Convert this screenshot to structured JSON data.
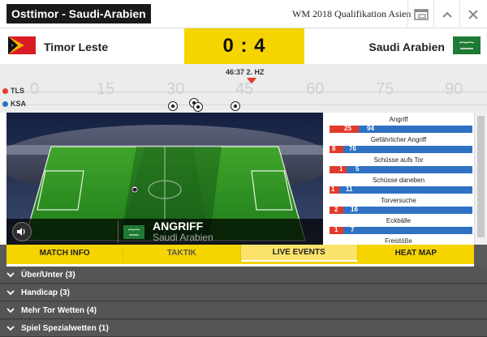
{
  "header": {
    "title": "Osttimor - Saudi-Arabien",
    "competition": "WM 2018 Qualifikation Asien"
  },
  "match": {
    "home_team": "Timor Leste",
    "away_team": "Saudi Arabien",
    "score": "0 : 4",
    "clock": "46:37 2. HZ"
  },
  "timeline": {
    "home_code": "TLS",
    "away_code": "KSA",
    "home_color": "#e33b2a",
    "away_color": "#2f72c4",
    "ticks": [
      "0",
      "15",
      "30",
      "45",
      "60",
      "75",
      "90"
    ],
    "events_icons": [
      "football-icon",
      "football-icon",
      "football-icon",
      "football-icon"
    ]
  },
  "live": {
    "action": "ANGRIFF",
    "team": "Saudi Arabien"
  },
  "stats": [
    {
      "label": "Angriff",
      "home": 25,
      "away": 94
    },
    {
      "label": "Gefährlicher Angriff",
      "home": 8,
      "away": 76
    },
    {
      "label": "Schüsse aufs Tor",
      "home": 1,
      "away": 5
    },
    {
      "label": "Schüsse daneben",
      "home": 1,
      "away": 11
    },
    {
      "label": "Torversuche",
      "home": 2,
      "away": 16
    },
    {
      "label": "Eckbälle",
      "home": 1,
      "away": 7
    },
    {
      "label": "Freistöße",
      "home": null,
      "away": null
    }
  ],
  "tabs": [
    "MATCH INFO",
    "TAKTIK",
    "LIVE EVENTS",
    "HEAT MAP"
  ],
  "markets": [
    "Über/Unter (3)",
    "Handicap (3)",
    "Mehr Tor Wetten (4)",
    "Spiel Spezialwetten (1)"
  ],
  "colors": {
    "accent": "#f5d400",
    "home": "#e33b2a",
    "away": "#2f72c4"
  }
}
